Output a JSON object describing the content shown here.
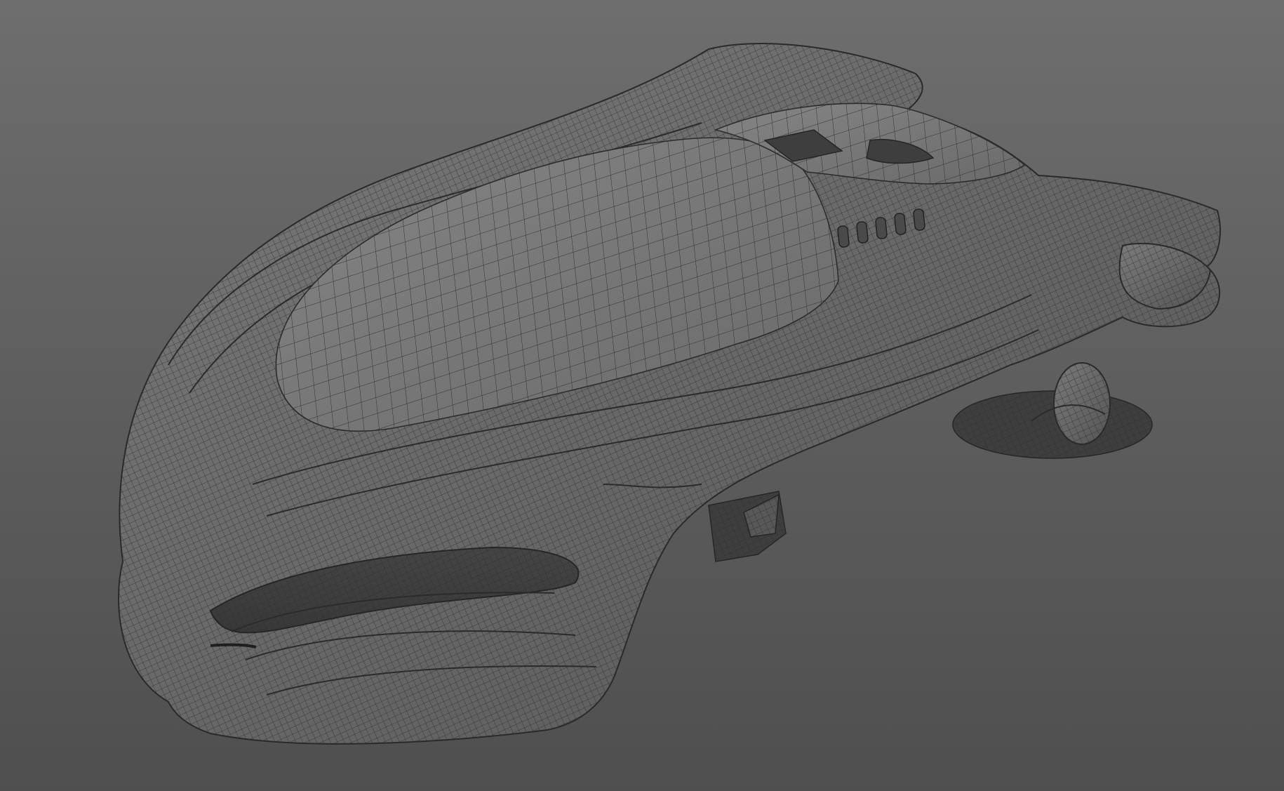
{
  "viewport": {
    "background_top": "#6e6e6e",
    "background_bottom": "#4f4f4f",
    "mesh_color": "#2e2e2e",
    "shading": "wireframe-on-shaded"
  },
  "model": {
    "subject": "hover-vehicle-icon"
  }
}
